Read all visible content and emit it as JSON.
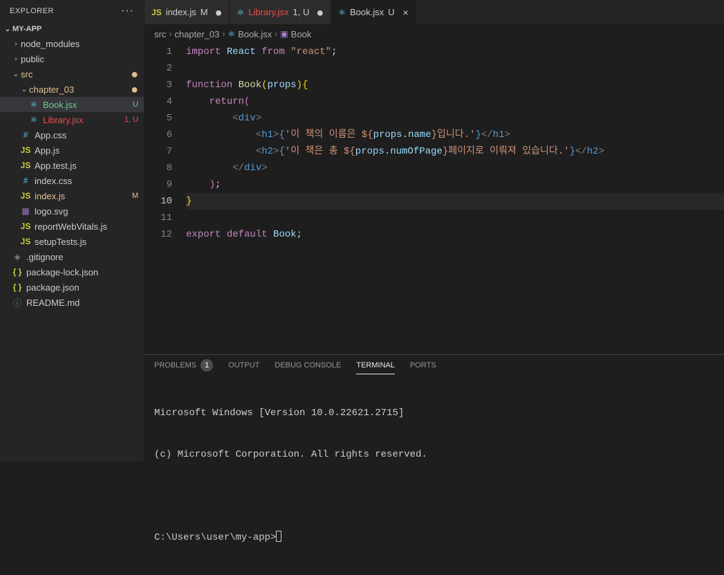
{
  "sidebar": {
    "header": "EXPLORER",
    "project": "MY-APP",
    "tree": [
      {
        "type": "folder",
        "label": "node_modules",
        "depth": 1,
        "expanded": false
      },
      {
        "type": "folder",
        "label": "public",
        "depth": 1,
        "expanded": false
      },
      {
        "type": "folder",
        "label": "src",
        "depth": 1,
        "expanded": true,
        "colorClass": "modified-orange",
        "marker": "●"
      },
      {
        "type": "folder",
        "label": "chapter_03",
        "depth": 2,
        "expanded": true,
        "colorClass": "modified-orange",
        "marker": "●"
      },
      {
        "type": "file",
        "label": "Book.jsx",
        "depth": 3,
        "icon": "react",
        "colorClass": "untracked-green",
        "status": "U",
        "active": true
      },
      {
        "type": "file",
        "label": "Library.jsx",
        "depth": 3,
        "icon": "react",
        "colorClass": "git-red",
        "status": "1, U"
      },
      {
        "type": "file",
        "label": "App.css",
        "depth": 2,
        "icon": "css"
      },
      {
        "type": "file",
        "label": "App.js",
        "depth": 2,
        "icon": "js"
      },
      {
        "type": "file",
        "label": "App.test.js",
        "depth": 2,
        "icon": "js"
      },
      {
        "type": "file",
        "label": "index.css",
        "depth": 2,
        "icon": "css"
      },
      {
        "type": "file",
        "label": "index.js",
        "depth": 2,
        "icon": "js",
        "colorClass": "modified-orange",
        "status": "M"
      },
      {
        "type": "file",
        "label": "logo.svg",
        "depth": 2,
        "icon": "svg"
      },
      {
        "type": "file",
        "label": "reportWebVitals.js",
        "depth": 2,
        "icon": "js"
      },
      {
        "type": "file",
        "label": "setupTests.js",
        "depth": 2,
        "icon": "js"
      },
      {
        "type": "file",
        "label": ".gitignore",
        "depth": 1,
        "icon": "git"
      },
      {
        "type": "file",
        "label": "package-lock.json",
        "depth": 1,
        "icon": "json"
      },
      {
        "type": "file",
        "label": "package.json",
        "depth": 1,
        "icon": "json"
      },
      {
        "type": "file",
        "label": "README.md",
        "depth": 1,
        "icon": "info"
      }
    ]
  },
  "tabs": [
    {
      "icon": "js",
      "label": "index.js",
      "status": "M",
      "colorClass": ""
    },
    {
      "icon": "react",
      "label": "Library.jsx",
      "status": "1, U",
      "colorClass": "git-red"
    },
    {
      "icon": "react",
      "label": "Book.jsx",
      "status": "U",
      "active": true,
      "close": true
    }
  ],
  "breadcrumb": {
    "parts": [
      "src",
      "chapter_03",
      "Book.jsx",
      "Book"
    ],
    "icons": [
      "",
      "",
      "react",
      "cube"
    ]
  },
  "code": {
    "lines": [
      {
        "n": 1,
        "html": "<span class='tok-import'>import</span> <span class='tok-var'>React</span> <span class='tok-import'>from</span> <span class='tok-string'>\"react\"</span><span class='tok-default'>;</span>"
      },
      {
        "n": 2,
        "html": ""
      },
      {
        "n": 3,
        "html": "<span class='tok-keyword'>function</span> <span class='tok-func'>Book</span><span class='tok-brace'>(</span><span class='tok-var'>props</span><span class='tok-brace'>)</span><span class='tok-brace'>{</span>"
      },
      {
        "n": 4,
        "html": "    <span class='tok-keyword'>return</span><span class='tok-brace2'>(</span>"
      },
      {
        "n": 5,
        "html": "        <span class='tok-tag'>&lt;</span><span class='tok-tagname'>div</span><span class='tok-tag'>&gt;</span>"
      },
      {
        "n": 6,
        "html": "            <span class='tok-tag'>&lt;</span><span class='tok-tagname'>h1</span><span class='tok-tag'>&gt;</span><span class='tok-jsx'>{</span><span class='tok-string'>'이 책의 이름은 ${</span><span class='tok-var'>props</span><span class='tok-default'>.</span><span class='tok-var'>name</span><span class='tok-string'>}입니다.'</span><span class='tok-jsx'>}</span><span class='tok-tag'>&lt;/</span><span class='tok-tagname'>h1</span><span class='tok-tag'>&gt;</span>"
      },
      {
        "n": 7,
        "html": "            <span class='tok-tag'>&lt;</span><span class='tok-tagname'>h2</span><span class='tok-tag'>&gt;</span><span class='tok-jsx'>{</span><span class='tok-string'>'이 책은 총 ${</span><span class='tok-var'>props</span><span class='tok-default'>.</span><span class='tok-var'>numOfPage</span><span class='tok-string'>}페이지로 이뤄져 있습니다.'</span><span class='tok-jsx'>}</span><span class='tok-tag'>&lt;/</span><span class='tok-tagname'>h2</span><span class='tok-tag'>&gt;</span>"
      },
      {
        "n": 8,
        "html": "        <span class='tok-tag'>&lt;/</span><span class='tok-tagname'>div</span><span class='tok-tag'>&gt;</span>"
      },
      {
        "n": 9,
        "html": "    <span class='tok-brace2'>)</span><span class='tok-default'>;</span>"
      },
      {
        "n": 10,
        "html": "<span class='tok-brace'>}</span>",
        "current": true
      },
      {
        "n": 11,
        "html": ""
      },
      {
        "n": 12,
        "html": "<span class='tok-keyword'>export</span> <span class='tok-keyword'>default</span> <span class='tok-var'>Book</span><span class='tok-default'>;</span>"
      }
    ]
  },
  "panel": {
    "tabs": [
      {
        "label": "PROBLEMS",
        "badge": "1"
      },
      {
        "label": "OUTPUT"
      },
      {
        "label": "DEBUG CONSOLE"
      },
      {
        "label": "TERMINAL",
        "active": true
      },
      {
        "label": "PORTS"
      }
    ],
    "terminal": {
      "line1": "Microsoft Windows [Version 10.0.22621.2715]",
      "line2": "(c) Microsoft Corporation. All rights reserved.",
      "prompt": "C:\\Users\\user\\my-app>"
    }
  },
  "icons": {
    "js": "JS",
    "react": "⚛",
    "css": "#",
    "svg": "▦",
    "json": "{ }",
    "git": "◈",
    "info": "ⓘ",
    "cube": "▣",
    "chevron_right": "›",
    "chevron_down": "⌄"
  }
}
